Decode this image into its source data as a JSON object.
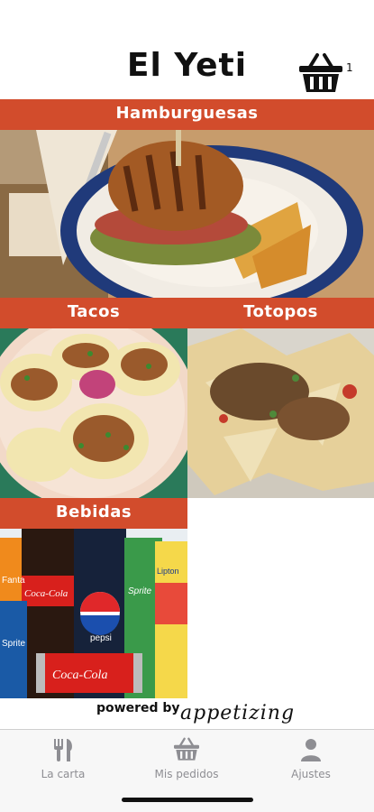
{
  "header": {
    "title": "El Yeti",
    "cart_icon": "basket-icon",
    "cart_count": "1"
  },
  "categories": [
    {
      "label": "Hamburguesas",
      "image": "burger-photo"
    },
    {
      "label": "Tacos",
      "image": "tacos-photo"
    },
    {
      "label": "Totopos",
      "image": "nachos-photo"
    },
    {
      "label": "Bebidas",
      "image": "drinks-photo"
    }
  ],
  "drinks_labels": {
    "fanta": "Fanta",
    "coca_cola": "Coca-Cola",
    "pepsi": "pepsi",
    "sprite": "Sprite",
    "lipton": "Lipton",
    "sprite_can": "Sprite"
  },
  "footer": {
    "powered_by": "powered by",
    "brand": "appetizing"
  },
  "tabs": [
    {
      "label": "La carta",
      "icon": "fork-knife-icon"
    },
    {
      "label": "Mis pedidos",
      "icon": "basket-icon"
    },
    {
      "label": "Ajustes",
      "icon": "person-icon"
    }
  ],
  "colors": {
    "accent": "#d24c2c",
    "tab_inactive": "#8e8e93",
    "tabbar_bg": "#f7f7f7"
  }
}
